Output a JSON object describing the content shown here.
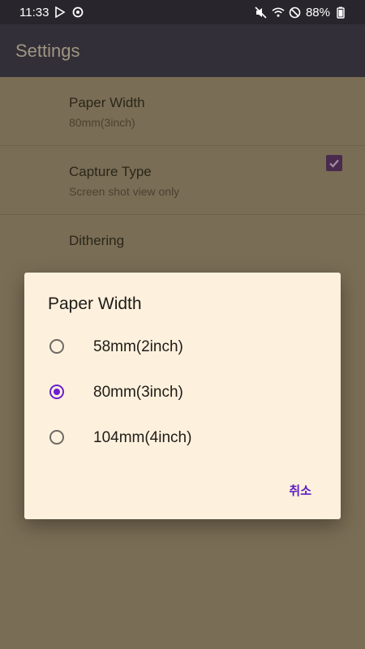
{
  "status": {
    "time": "11:33",
    "battery": "88%"
  },
  "appbar": {
    "title": "Settings"
  },
  "settings": {
    "items": [
      {
        "title": "Paper Width",
        "subtitle": "80mm(3inch)"
      },
      {
        "title": "Capture Type",
        "subtitle": "Screen shot view only"
      },
      {
        "title": "Dithering",
        "checked": true
      }
    ]
  },
  "dialog": {
    "title": "Paper Width",
    "options": [
      {
        "label": "58mm(2inch)",
        "selected": false
      },
      {
        "label": "80mm(3inch)",
        "selected": true
      },
      {
        "label": "104mm(4inch)",
        "selected": false
      }
    ],
    "cancel_label": "취소"
  },
  "colors": {
    "accent": "#6b1fd1",
    "dialog_bg": "#fdf1de",
    "scrim_bg": "#7a6d55"
  },
  "icons": [
    "play-store-icon",
    "record-icon",
    "mute-icon",
    "wifi-icon",
    "do-not-disturb-icon",
    "battery-icon",
    "check-icon"
  ]
}
